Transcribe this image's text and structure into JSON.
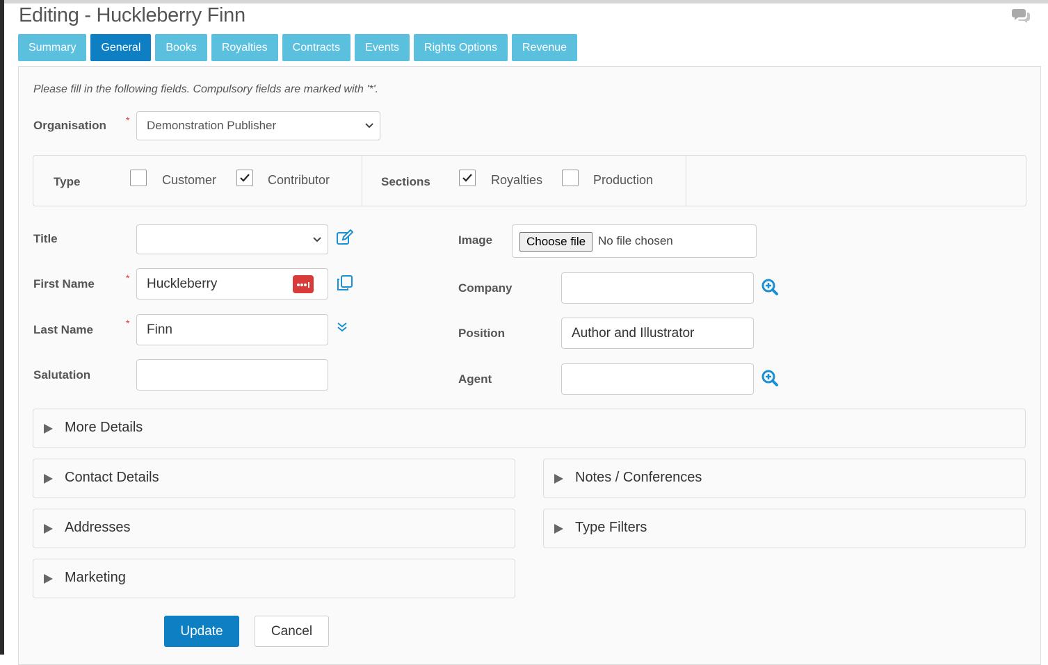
{
  "header": {
    "title": "Editing - Huckleberry Finn",
    "chat_icon": "comments-icon"
  },
  "tabs": [
    {
      "label": "Summary",
      "active": false
    },
    {
      "label": "General",
      "active": true
    },
    {
      "label": "Books",
      "active": false
    },
    {
      "label": "Royalties",
      "active": false
    },
    {
      "label": "Contracts",
      "active": false
    },
    {
      "label": "Events",
      "active": false
    },
    {
      "label": "Rights Options",
      "active": false
    },
    {
      "label": "Revenue",
      "active": false
    }
  ],
  "form": {
    "note": "Please fill in the following fields. Compulsory fields are marked with '*'.",
    "required_marker": "*",
    "organisation": {
      "label": "Organisation",
      "value": "Demonstration Publisher"
    },
    "type": {
      "label": "Type",
      "options": [
        {
          "label": "Customer",
          "checked": false
        },
        {
          "label": "Contributor",
          "checked": true
        }
      ]
    },
    "sections": {
      "label": "Sections",
      "options": [
        {
          "label": "Royalties",
          "checked": true
        },
        {
          "label": "Production",
          "checked": false
        }
      ]
    },
    "title": {
      "label": "Title",
      "value": ""
    },
    "first_name": {
      "label": "First Name",
      "value": "Huckleberry"
    },
    "last_name": {
      "label": "Last Name",
      "value": "Finn"
    },
    "salutation": {
      "label": "Salutation",
      "value": ""
    },
    "image": {
      "label": "Image",
      "button": "Choose file",
      "status": "No file chosen"
    },
    "company": {
      "label": "Company",
      "value": ""
    },
    "position": {
      "label": "Position",
      "value": "Author and Illustrator"
    },
    "agent": {
      "label": "Agent",
      "value": ""
    }
  },
  "accordions": {
    "more_details": "More Details",
    "contact_details": "Contact Details",
    "notes_conferences": "Notes / Conferences",
    "addresses": "Addresses",
    "type_filters": "Type Filters",
    "marketing": "Marketing"
  },
  "actions": {
    "update": "Update",
    "cancel": "Cancel"
  },
  "colors": {
    "tab": "#5bc0de",
    "tab_active": "#0f7fc4",
    "primary": "#0f7fc4",
    "required": "#e53935",
    "icon_blue": "#1a8fd1"
  }
}
